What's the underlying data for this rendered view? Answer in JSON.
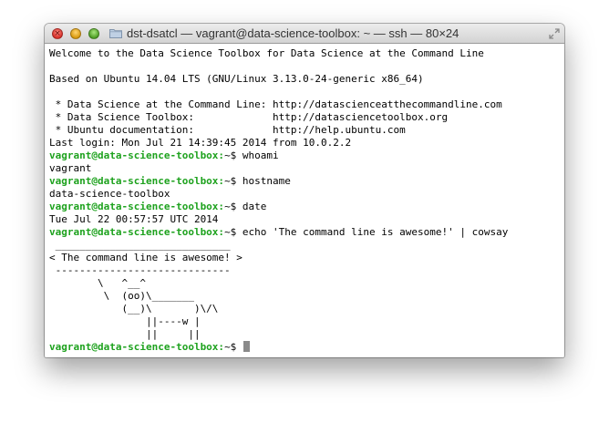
{
  "window": {
    "title": "dst-dsatcl — vagrant@data-science-toolbox: ~ — ssh — 80×24"
  },
  "colors": {
    "prompt": "#1ea21e",
    "close": "#e0443e",
    "minimize": "#e6a21c",
    "zoom": "#5fad2e"
  },
  "icons": {
    "close": "close-icon",
    "minimize": "minimize-icon",
    "zoom": "zoom-icon",
    "folder": "folder-icon",
    "resize": "fullscreen-icon"
  },
  "terminal": {
    "lines": [
      {
        "text": "Welcome to the Data Science Toolbox for Data Science at the Command Line"
      },
      {
        "text": ""
      },
      {
        "text": "Based on Ubuntu 14.04 LTS (GNU/Linux 3.13.0-24-generic x86_64)"
      },
      {
        "text": ""
      },
      {
        "text": " * Data Science at the Command Line: http://datascienceatthecommandline.com"
      },
      {
        "text": " * Data Science Toolbox:             http://datasciencetoolbox.org"
      },
      {
        "text": " * Ubuntu documentation:             http://help.ubuntu.com"
      },
      {
        "text": "Last login: Mon Jul 21 14:39:45 2014 from 10.0.2.2"
      },
      {
        "prompt": "vagrant@data-science-toolbox:",
        "text": "~$ whoami"
      },
      {
        "text": "vagrant"
      },
      {
        "prompt": "vagrant@data-science-toolbox:",
        "text": "~$ hostname"
      },
      {
        "text": "data-science-toolbox"
      },
      {
        "prompt": "vagrant@data-science-toolbox:",
        "text": "~$ date"
      },
      {
        "text": "Tue Jul 22 00:57:57 UTC 2014"
      },
      {
        "prompt": "vagrant@data-science-toolbox:",
        "text": "~$ echo 'The command line is awesome!' | cowsay"
      },
      {
        "text": " _____________________________"
      },
      {
        "text": "< The command line is awesome! >"
      },
      {
        "text": " -----------------------------"
      },
      {
        "text": "        \\   ^__^"
      },
      {
        "text": "         \\  (oo)\\_______"
      },
      {
        "text": "            (__)\\       )\\/\\"
      },
      {
        "text": "                ||----w |"
      },
      {
        "text": "                ||     ||"
      },
      {
        "prompt": "vagrant@data-science-toolbox:",
        "text": "~$ ",
        "cursor": true
      }
    ]
  }
}
